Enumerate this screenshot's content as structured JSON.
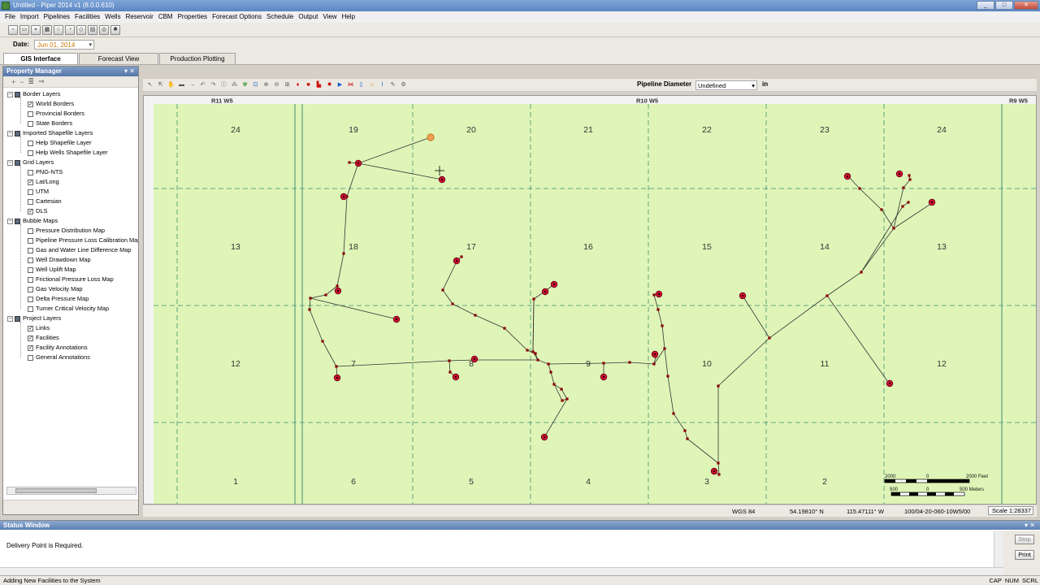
{
  "app": {
    "title": "Untitled - Piper 2014 v1 (8.0.0.610)",
    "menu": [
      "File",
      "Import",
      "Pipelines",
      "Facilities",
      "Wells",
      "Reservoir",
      "CBM",
      "Properties",
      "Forecast Options",
      "Schedule",
      "Output",
      "View",
      "Help"
    ]
  },
  "datebar": {
    "label": "Date:",
    "value": "Jun 01, 2014"
  },
  "tabs": [
    {
      "label": "GIS Interface",
      "active": true
    },
    {
      "label": "Forecast View",
      "active": false
    },
    {
      "label": "Production Plotting",
      "active": false
    }
  ],
  "property_manager": {
    "title": "Property Manager",
    "groups": [
      {
        "label": "Border Layers",
        "items": [
          {
            "label": "World Borders",
            "checked": true
          },
          {
            "label": "Provincial Borders",
            "checked": false
          },
          {
            "label": "State Borders",
            "checked": false
          }
        ]
      },
      {
        "label": "Imported Shapefile Layers",
        "items": [
          {
            "label": "Help Shapefile Layer",
            "checked": false
          },
          {
            "label": "Help Wells Shapefile Layer",
            "checked": false
          }
        ]
      },
      {
        "label": "Grid Layers",
        "items": [
          {
            "label": "PNG-NTS",
            "checked": false
          },
          {
            "label": "Lat/Long",
            "checked": true
          },
          {
            "label": "UTM",
            "checked": false
          },
          {
            "label": "Cartesian",
            "checked": false
          },
          {
            "label": "DLS",
            "checked": true
          }
        ]
      },
      {
        "label": "Bubble Maps",
        "items": [
          {
            "label": "Pressure Distribution Map",
            "checked": false
          },
          {
            "label": "Pipeline Pressure Loss Calibration Map",
            "checked": false
          },
          {
            "label": "Gas and Water Line Difference Map",
            "checked": false
          },
          {
            "label": "Well Drawdown Map",
            "checked": false
          },
          {
            "label": "Well Uplift Map",
            "checked": false
          },
          {
            "label": "Frictional Pressure Loss Map",
            "checked": false
          },
          {
            "label": "Gas Velocity Map",
            "checked": false
          },
          {
            "label": "Delta Pressure Map",
            "checked": false
          },
          {
            "label": "Turner Critical Velocity Map",
            "checked": false
          }
        ]
      },
      {
        "label": "Project Layers",
        "items": [
          {
            "label": "Links",
            "checked": true
          },
          {
            "label": "Facilities",
            "checked": true
          },
          {
            "label": "Facility Annotations",
            "checked": true
          },
          {
            "label": "General Annotations",
            "checked": false
          }
        ]
      }
    ]
  },
  "map_toolbar": {
    "pipeline_diameter_label": "Pipeline Diameter",
    "pipeline_diameter_value": "Undefined",
    "unit": "in"
  },
  "map": {
    "range_labels": [
      "R11 W5",
      "R10 W5",
      "R9 W5"
    ],
    "section_numbers": {
      "row1": [
        "24",
        "19",
        "20",
        "21",
        "22",
        "23",
        "24"
      ],
      "row2": [
        "13",
        "18",
        "17",
        "16",
        "15",
        "14",
        "13"
      ],
      "row3": [
        "12",
        "7",
        "8",
        "9",
        "10",
        "11",
        "12"
      ],
      "row4": [
        "1",
        "6",
        "5",
        "4",
        "3",
        "2"
      ]
    },
    "scalebar": {
      "feet_left": "2000",
      "feet_mid": "0",
      "feet_right": "2000 Feet",
      "m_left": "500",
      "m_mid": "0",
      "m_right": "500 Meters"
    },
    "colors": {
      "land": "#dff5b8",
      "grid": "#3f8f6f",
      "link": "#333333",
      "node": "#8b0000",
      "well": "#cc1133",
      "selected": "#f0a050"
    }
  },
  "coords": {
    "datum": "WGS 84",
    "lat": "54.19810° N",
    "lon": "115.47111° W",
    "uwi": "100/04-20-060-10W5/00",
    "scale": "Scale 1:28337"
  },
  "status_window": {
    "title": "Status Window",
    "message": "Delivery Point is Required.",
    "stop": "Stop",
    "print": "Print"
  },
  "statusbar": {
    "message": "Adding New Facilities to the System",
    "indicators": [
      "CAP",
      "NUM",
      "SCRL"
    ]
  }
}
